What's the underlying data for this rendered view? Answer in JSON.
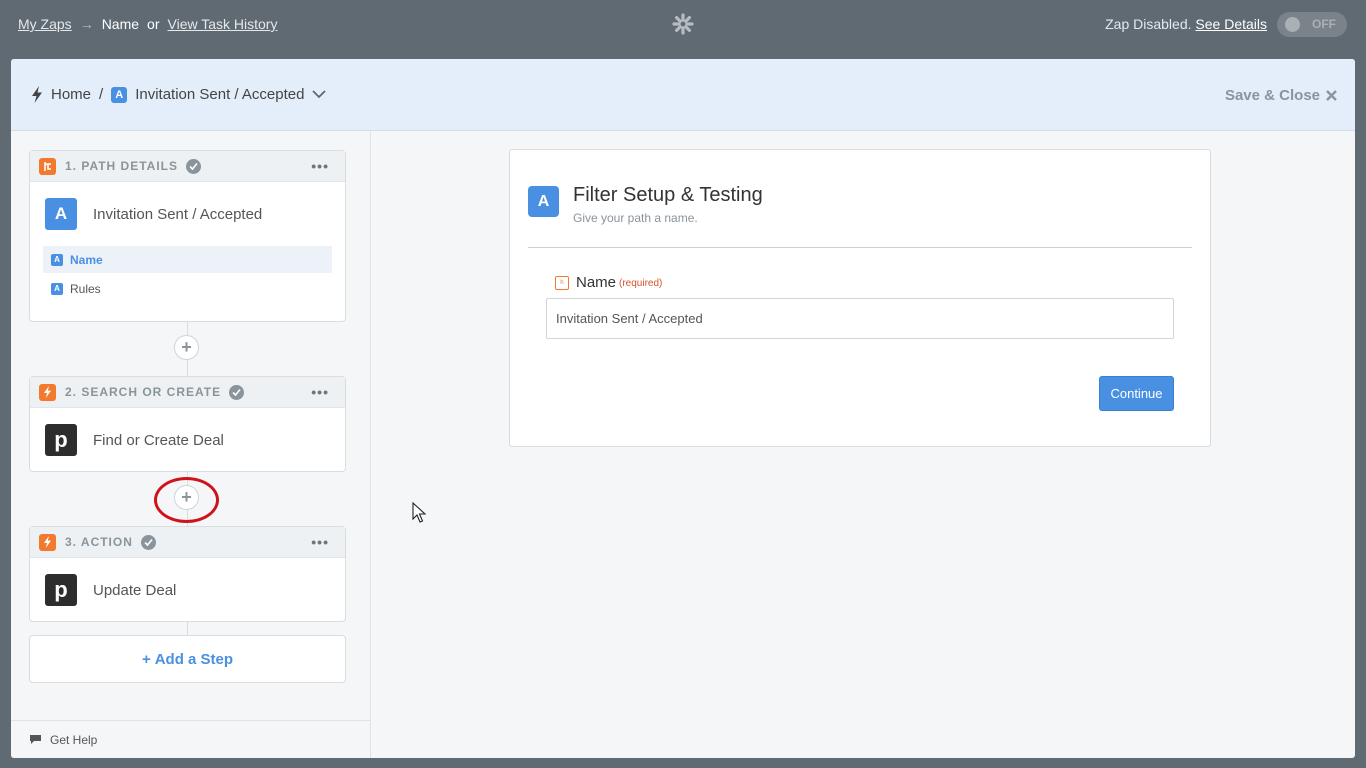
{
  "topbar": {
    "my_zaps": "My Zaps",
    "arrow": "→",
    "current": "Name",
    "or": "or",
    "task_history": "View Task History",
    "status_text": "Zap Disabled.",
    "see_details": "See Details",
    "toggle_label": "OFF"
  },
  "header": {
    "home": "Home",
    "sep": "/",
    "badge": "A",
    "path_name": "Invitation Sent / Accepted",
    "save_close": "Save & Close"
  },
  "steps": [
    {
      "header": "1. PATH DETAILS",
      "app_badge": "A",
      "title": "Invitation Sent / Accepted",
      "subitems": [
        {
          "badge": "A",
          "label": "Name",
          "active": true
        },
        {
          "badge": "A",
          "label": "Rules",
          "active": false
        }
      ]
    },
    {
      "header": "2. SEARCH OR CREATE",
      "app_badge": "p",
      "title": "Find or Create Deal"
    },
    {
      "header": "3. ACTION",
      "app_badge": "p",
      "title": "Update Deal"
    }
  ],
  "sidebar": {
    "add_step": "Add a Step",
    "get_help": "Get Help"
  },
  "panel": {
    "badge": "A",
    "title": "Filter Setup & Testing",
    "subtitle": "Give your path a name.",
    "field_label": "Name",
    "field_required": "(required)",
    "field_value": "Invitation Sent / Accepted",
    "continue": "Continue"
  },
  "colors": {
    "accent": "#4a90e2",
    "orange": "#f27a2e",
    "highlight_ring": "#d0121b",
    "topbar": "#5f6a72"
  }
}
